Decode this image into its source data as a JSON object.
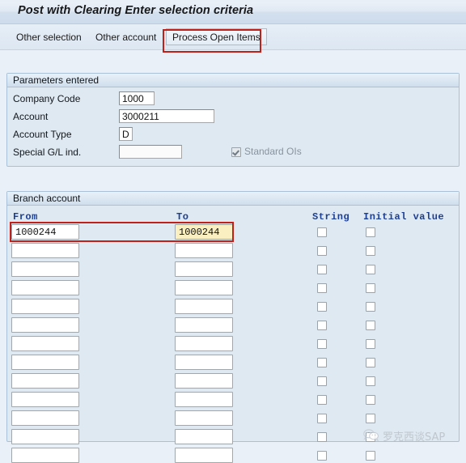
{
  "window": {
    "title": "Post with Clearing Enter selection criteria"
  },
  "toolbar": {
    "other_selection_label": "Other selection",
    "other_account_label": "Other account",
    "process_open_items_label": "Process Open Items"
  },
  "annotations": {
    "highlight_color": "#c0201a"
  },
  "parameters_panel": {
    "title": "Parameters entered",
    "fields": [
      {
        "label": "Company Code",
        "value": "1000"
      },
      {
        "label": "Account",
        "value": "3000211"
      },
      {
        "label": "Account Type",
        "value": "D"
      },
      {
        "label": "Special G/L ind.",
        "value": ""
      }
    ],
    "standard_ois": {
      "label": "Standard OIs",
      "checked": true,
      "disabled": true
    }
  },
  "branch_panel": {
    "title": "Branch account",
    "columns": {
      "from": "From",
      "to": "To",
      "string": "String",
      "initial_value": "Initial value"
    },
    "rows": [
      {
        "from": "1000244",
        "to": "1000244",
        "string": false,
        "initial_value": false,
        "focused": true
      },
      {
        "from": "",
        "to": "",
        "string": false,
        "initial_value": false,
        "focused": false
      },
      {
        "from": "",
        "to": "",
        "string": false,
        "initial_value": false,
        "focused": false
      },
      {
        "from": "",
        "to": "",
        "string": false,
        "initial_value": false,
        "focused": false
      },
      {
        "from": "",
        "to": "",
        "string": false,
        "initial_value": false,
        "focused": false
      },
      {
        "from": "",
        "to": "",
        "string": false,
        "initial_value": false,
        "focused": false
      },
      {
        "from": "",
        "to": "",
        "string": false,
        "initial_value": false,
        "focused": false
      },
      {
        "from": "",
        "to": "",
        "string": false,
        "initial_value": false,
        "focused": false
      },
      {
        "from": "",
        "to": "",
        "string": false,
        "initial_value": false,
        "focused": false
      },
      {
        "from": "",
        "to": "",
        "string": false,
        "initial_value": false,
        "focused": false
      },
      {
        "from": "",
        "to": "",
        "string": false,
        "initial_value": false,
        "focused": false
      },
      {
        "from": "",
        "to": "",
        "string": false,
        "initial_value": false,
        "focused": false
      },
      {
        "from": "",
        "to": "",
        "string": false,
        "initial_value": false,
        "focused": false
      }
    ]
  },
  "watermark": {
    "text": "罗克西谈SAP",
    "icon": "wechat-icon"
  }
}
